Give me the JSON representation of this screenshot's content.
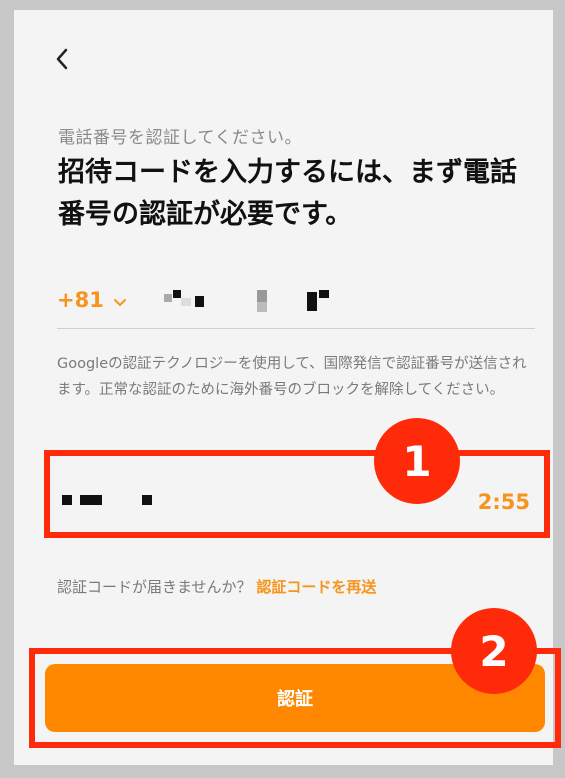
{
  "header": {
    "back_icon": "chevron-left-icon"
  },
  "intro": {
    "subtitle": "電話番号を認証してください。",
    "headline": "招待コードを入力するには、まず電話番号の認証が必要です。"
  },
  "phone": {
    "country_code": "+81",
    "country_dropdown_icon": "chevron-down-icon"
  },
  "notice": {
    "text": "Googleの認証テクノロジーを使用して、国際発信で認証番号が送信されます。正常な認証のために海外番号のブロックを解除してください。"
  },
  "verification": {
    "timer": "2:55"
  },
  "annotations": {
    "badge_1": "1",
    "badge_2": "2"
  },
  "resend": {
    "prompt": "認証コードが届きませんか？",
    "link": "認証コードを再送"
  },
  "actions": {
    "verify": "認証"
  },
  "colors": {
    "accent": "#f7941d",
    "button": "#ff8800",
    "annotation": "#ff2a0a",
    "background": "#f4f4f4"
  }
}
